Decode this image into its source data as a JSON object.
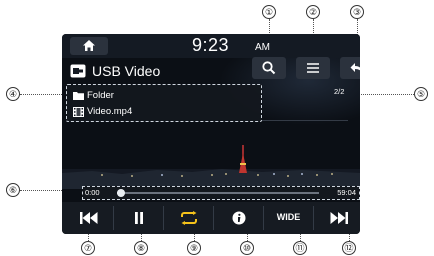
{
  "status_bar": {
    "time": "9:23",
    "ampm": "AM"
  },
  "header": {
    "title": "USB Video",
    "page_indicator": "2/2"
  },
  "file_list": [
    {
      "name": "Folder",
      "icon": "folder-icon"
    },
    {
      "name": "Video.mp4",
      "icon": "video-file-icon"
    }
  ],
  "playback": {
    "elapsed": "0:00",
    "total": "59:04",
    "progress_fraction": 0.02
  },
  "controls": {
    "wide_label": "WIDE"
  },
  "callouts": {
    "c1": "①",
    "c2": "②",
    "c3": "③",
    "c4": "④",
    "c5": "⑤",
    "c6": "⑥",
    "c7": "⑦",
    "c8": "⑧",
    "c9": "⑨",
    "c10": "⑩",
    "c11": "⑪",
    "c12": "⑫"
  },
  "colors": {
    "accent_repeat": "#f4c21b",
    "screen_bg": "#0b0f15",
    "button_bg": "#2b323d"
  }
}
